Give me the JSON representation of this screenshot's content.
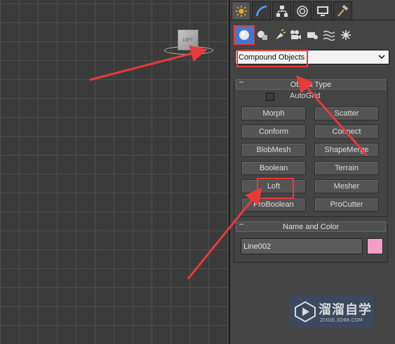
{
  "viewport": {
    "view_cube_label": "LEFT"
  },
  "command_panel": {
    "tabs": [
      {
        "name": "create-tab",
        "icon": "sun-burst-icon"
      },
      {
        "name": "modify-tab",
        "icon": "modify-arc-icon"
      },
      {
        "name": "hierarchy-tab",
        "icon": "hierarchy-icon"
      },
      {
        "name": "motion-tab",
        "icon": "motion-ring-icon"
      },
      {
        "name": "display-tab",
        "icon": "monitor-icon"
      },
      {
        "name": "utilities-tab",
        "icon": "hammer-icon"
      }
    ],
    "categories": [
      {
        "name": "geometry",
        "icon": "sphere-icon"
      },
      {
        "name": "shapes",
        "icon": "shapes-icon"
      },
      {
        "name": "lights",
        "icon": "light-icon"
      },
      {
        "name": "cameras",
        "icon": "camera-icon"
      },
      {
        "name": "helpers",
        "icon": "helper-icon"
      },
      {
        "name": "space-warps",
        "icon": "wave-icon"
      },
      {
        "name": "systems",
        "icon": "gear-icon"
      }
    ],
    "dropdown_value": "Compound Objects",
    "object_type": {
      "title": "Object Type",
      "collapse": "–",
      "autogrid_label": "AutoGrid",
      "buttons": [
        "Morph",
        "Scatter",
        "Conform",
        "Connect",
        "BlobMesh",
        "ShapeMerge",
        "Boolean",
        "Terrain",
        "Loft",
        "Mesher",
        "ProBoolean",
        "ProCutter"
      ]
    },
    "name_and_color": {
      "title": "Name and Color",
      "collapse": "–",
      "name_value": "Line002",
      "swatch_color": "#f29ec6"
    }
  },
  "watermark": {
    "title": "溜溜自学",
    "subtitle": "ZIXUE.3D66.COM"
  },
  "colors": {
    "highlight": "#e83a3a",
    "accent_blue": "#3b7bd4"
  }
}
